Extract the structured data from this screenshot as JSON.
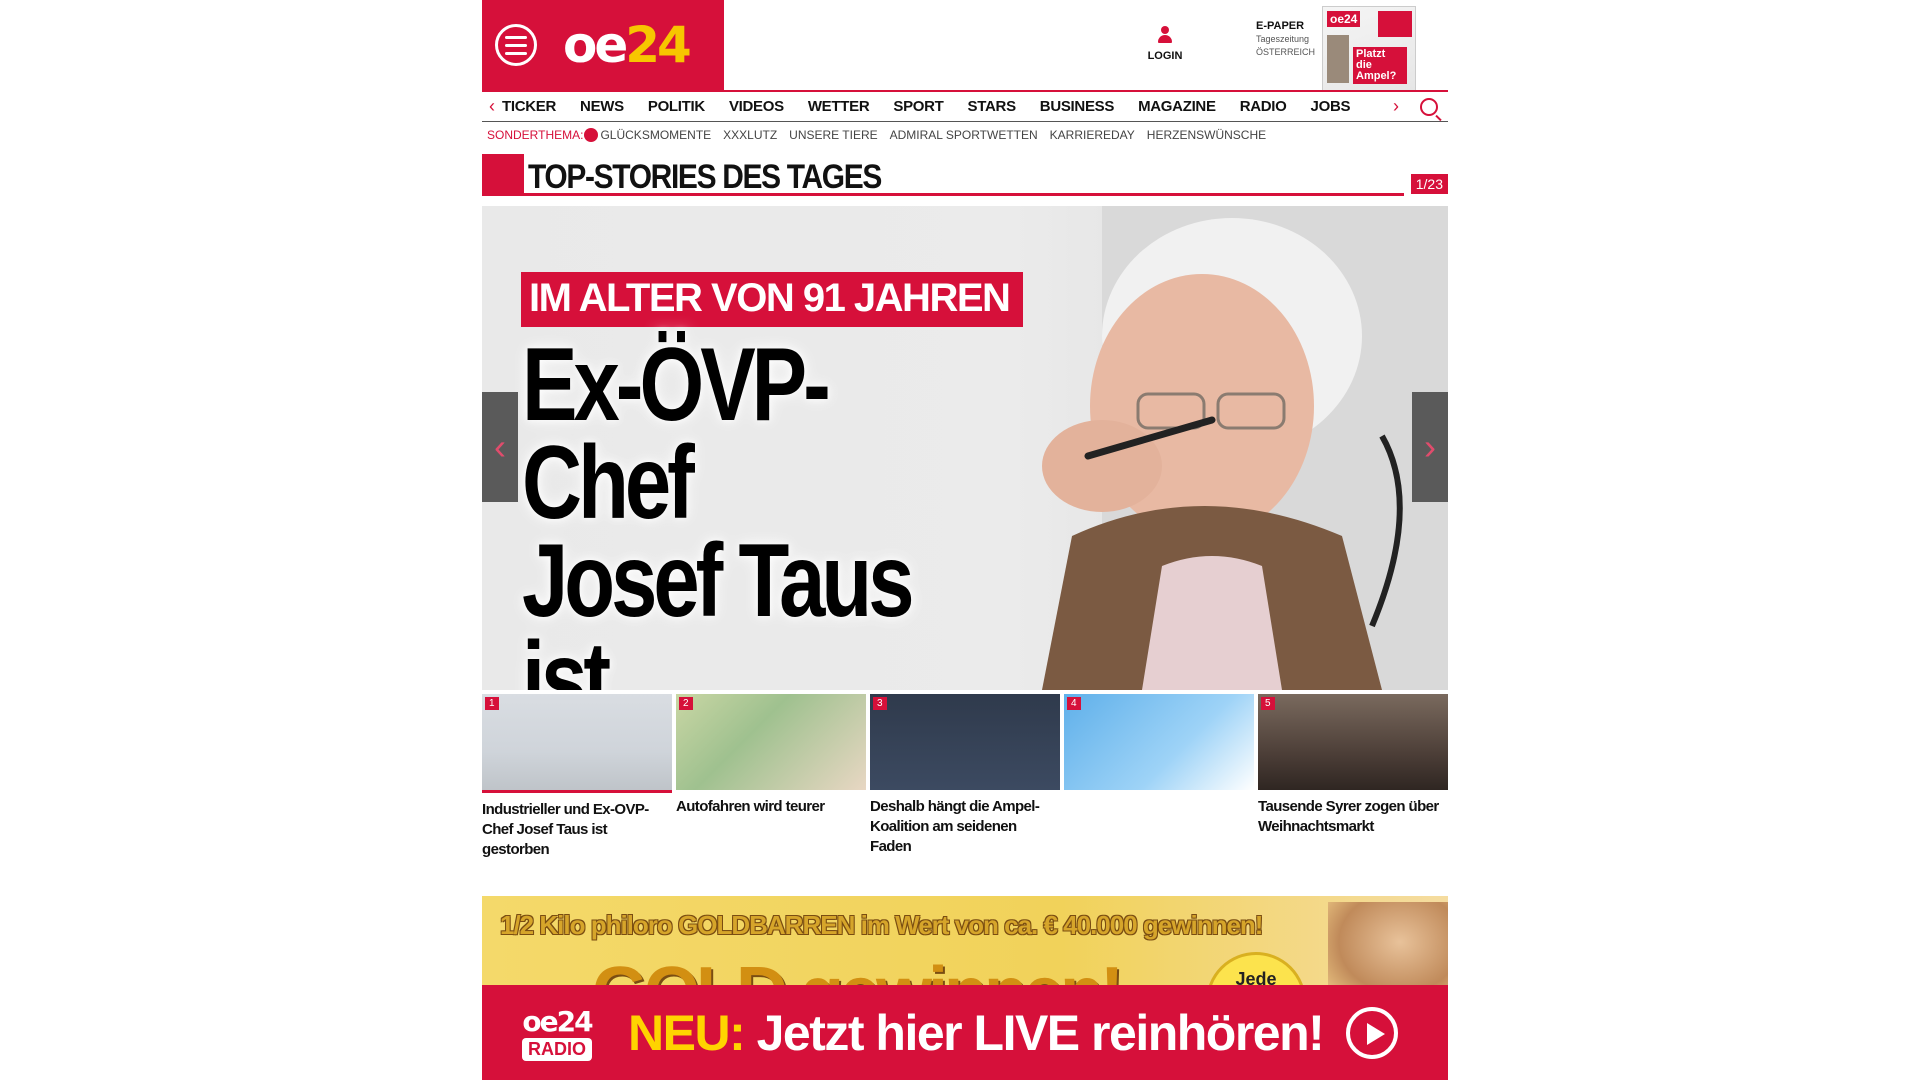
{
  "header": {
    "logo": "oe24",
    "login_label": "LOGIN",
    "epaper": {
      "label": "E-PAPER",
      "line2": "Tageszeitung",
      "line3": "ÖSTERREICH",
      "cover_logo": "oe24",
      "cover_headline": "Platzt die Ampel?"
    }
  },
  "nav": {
    "items": [
      "TICKER",
      "NEWS",
      "POLITIK",
      "VIDEOS",
      "WETTER",
      "SPORT",
      "STARS",
      "BUSINESS",
      "MAGAZINE",
      "RADIO",
      "JOBS"
    ],
    "prev_icon": "chevron-left-icon",
    "next_icon": "chevron-right-icon",
    "search_icon": "search-icon"
  },
  "subnav": {
    "label": "SONDERTHEMA:",
    "items": [
      "GLÜCKSMOMENTE",
      "XXXLUTZ",
      "UNSERE TIERE",
      "ADMIRAL SPORTWETTEN",
      "KARRIEREDAY",
      "HERZENSWÜNSCHE"
    ]
  },
  "section": {
    "title": "TOP-STORIES DES TAGES",
    "counter": "1/23"
  },
  "hero": {
    "kicker": "IM ALTER VON 91 JAHREN",
    "headline_line1": "Ex-ÖVP-Chef",
    "headline_line2": "Josef Taus",
    "headline_line3": "ist gestorben"
  },
  "teasers": [
    {
      "num": "1",
      "title": "Industrieller und Ex-OVP-Chef Josef Taus ist gestorben"
    },
    {
      "num": "2",
      "title": "Autofahren wird teurer"
    },
    {
      "num": "3",
      "title": "Deshalb hängt die Ampel-Koalition am seidenen Faden"
    },
    {
      "num": "4",
      "title": ""
    },
    {
      "num": "5",
      "title": "Tausende Syrer zogen über Weihnachtsmarkt"
    }
  ],
  "ad": {
    "title": "1/2 Kilo philoro GOLDBARREN im Wert von ca. € 40.000 gewinnen!",
    "big": "GOLD gewinnen!",
    "circle": "Jede Stunde"
  },
  "radio": {
    "logo_top": "oe24",
    "logo_bottom": "RADIO",
    "neu": "NEU:",
    "text": "Jetzt hier LIVE reinhören!"
  },
  "colors": {
    "brand_red": "#d6103a",
    "accent_yellow": "#ffd400"
  }
}
